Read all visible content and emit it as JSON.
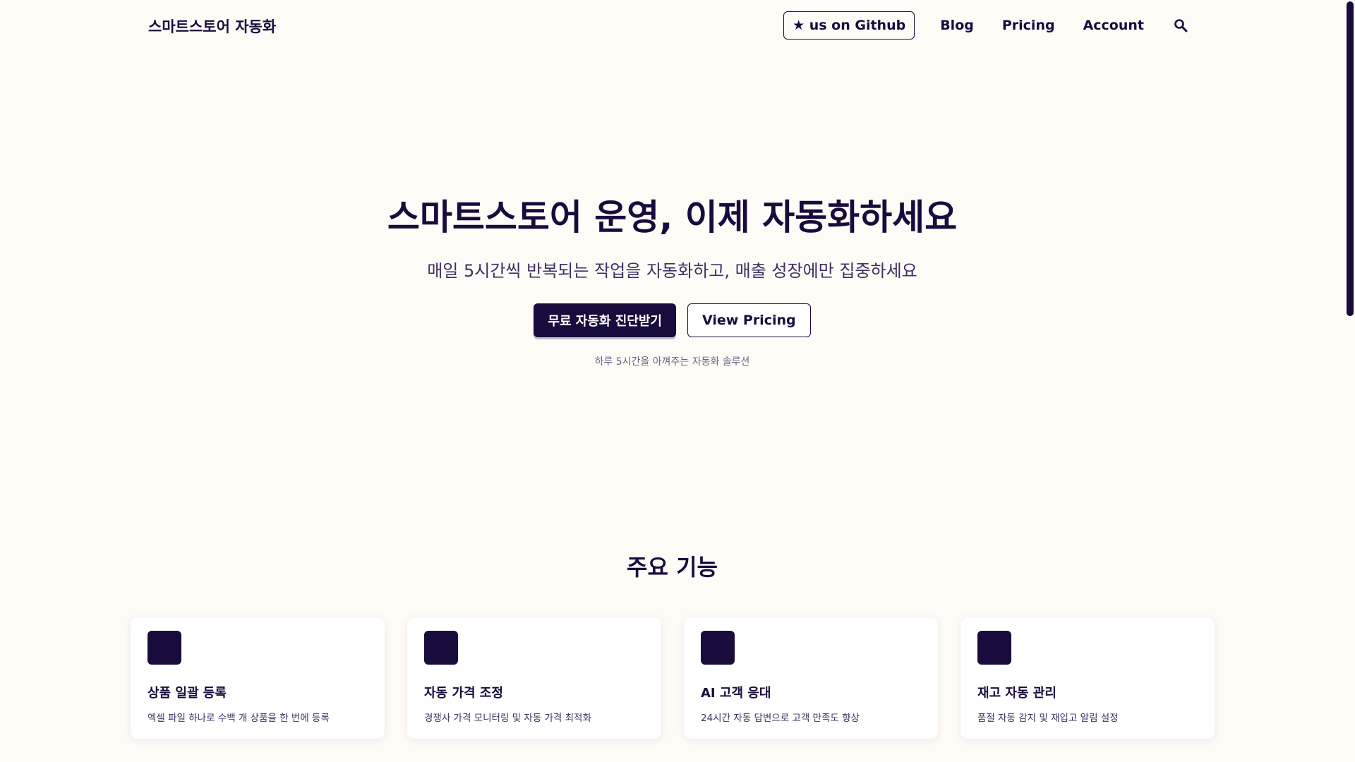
{
  "header": {
    "brand": "스마트스토어 자동화",
    "github_label": "★ us on Github",
    "nav": [
      {
        "label": "Blog"
      },
      {
        "label": "Pricing"
      },
      {
        "label": "Account"
      }
    ],
    "search_icon": "search-icon"
  },
  "hero": {
    "title": "스마트스토어 운영, 이제 자동화하세요",
    "subtitle": "매일 5시간씩 반복되는 작업을 자동화하고, 매출 성장에만 집중하세요",
    "primary_cta": "무료 자동화 진단받기",
    "secondary_cta": "View Pricing",
    "note": "하루 5시간을 아껴주는 자동화 솔루션"
  },
  "features": {
    "title": "주요 기능",
    "cards": [
      {
        "title": "상품 일괄 등록",
        "desc": "엑셀 파일 하나로 수백 개 상품을 한 번에 등록"
      },
      {
        "title": "자동 가격 조정",
        "desc": "경쟁사 가격 모니터링 및 자동 가격 최적화"
      },
      {
        "title": "AI 고객 응대",
        "desc": "24시간 자동 답변으로 고객 만족도 향상"
      },
      {
        "title": "재고 자동 관리",
        "desc": "품절 자동 감지 및 재입고 알림 설정"
      }
    ]
  },
  "colors": {
    "background": "#fffbf7",
    "primary": "#1a0b3d",
    "card": "#ffffff"
  }
}
